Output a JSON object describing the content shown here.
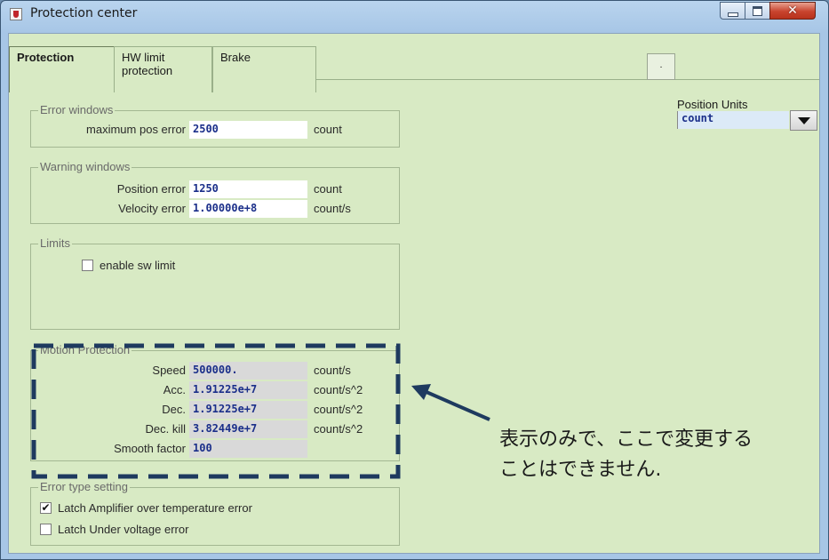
{
  "window": {
    "title": "Protection center",
    "minimize_icon": "minimize-icon",
    "maximize_icon": "maximize-icon",
    "close_icon": "close-icon",
    "close_glyph": "✕"
  },
  "tabs": [
    {
      "label": "Protection"
    },
    {
      "label": "HW limit\nprotection"
    },
    {
      "label": "Brake"
    }
  ],
  "small_button": {
    "label": "."
  },
  "position_units": {
    "label": "Position Units",
    "value": "count"
  },
  "error_windows": {
    "title": "Error windows",
    "rows": [
      {
        "label": "maximum pos error",
        "value": "2500",
        "unit": "count"
      }
    ]
  },
  "warning_windows": {
    "title": "Warning windows",
    "rows": [
      {
        "label": "Position error",
        "value": "1250",
        "unit": "count"
      },
      {
        "label": "Velocity error",
        "value": "1.00000e+8",
        "unit": "count/s"
      }
    ]
  },
  "limits": {
    "title": "Limits",
    "enable_sw_limit": {
      "label": "enable sw limit",
      "checked": false
    }
  },
  "motion_protection": {
    "title": "Motion Protection",
    "rows": [
      {
        "label": "Speed",
        "value": "500000.",
        "unit": "count/s"
      },
      {
        "label": "Acc.",
        "value": "1.91225e+7",
        "unit": "count/s^2"
      },
      {
        "label": "Dec.",
        "value": "1.91225e+7",
        "unit": "count/s^2"
      },
      {
        "label": "Dec. kill",
        "value": "3.82449e+7",
        "unit": "count/s^2"
      },
      {
        "label": "Smooth factor",
        "value": "100",
        "unit": ""
      }
    ]
  },
  "error_type_setting": {
    "title": "Error type setting",
    "options": [
      {
        "label": "Latch Amplifier over temperature error",
        "checked": true,
        "mark": "✔"
      },
      {
        "label": "Latch Under voltage error",
        "checked": false,
        "mark": ""
      }
    ]
  },
  "annotation": {
    "line1": "表示のみで、ここで変更する",
    "line2": "ことはできません.",
    "color": "#1e3a5f"
  }
}
